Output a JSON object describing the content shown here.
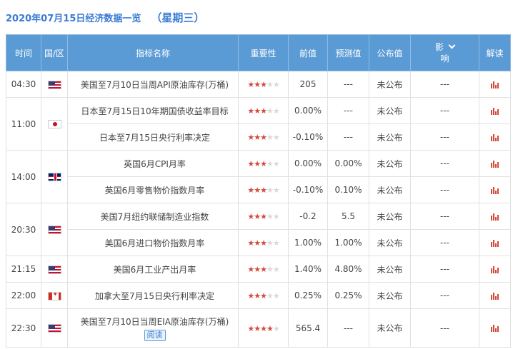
{
  "header": {
    "date_title": "2020年07月15日经济数据一览",
    "weekday": "（星期三）"
  },
  "columns": {
    "time": "时间",
    "region": "国/区",
    "indicator": "指标名称",
    "importance": "重要性",
    "previous": "前值",
    "forecast": "预测值",
    "actual": "公布值",
    "effect_line1": "影",
    "effect_line2": "响",
    "analysis": "解读"
  },
  "flag_icons": {
    "US": "flag-us-icon",
    "JP": "flag-jp-icon",
    "GB": "flag-gb-icon",
    "CA": "flag-ca-icon"
  },
  "colors": {
    "header_bg": "#5b9bd5",
    "accent_red": "#c0392b",
    "title_blue": "#3a7bd5"
  },
  "read_label": "阅读",
  "groups": [
    {
      "time": "04:30",
      "country": "US",
      "rows": [
        {
          "name": "美国至7月10日当周API原油库存(万桶)",
          "stars": 3,
          "previous": "205",
          "forecast": "---",
          "actual": "未公布",
          "effect": "---"
        }
      ]
    },
    {
      "time": "11:00",
      "country": "JP",
      "rows": [
        {
          "name": "日本至7月15日10年期国债收益率目标",
          "stars": 3,
          "previous": "0.00%",
          "forecast": "---",
          "actual": "未公布",
          "effect": "---"
        },
        {
          "name": "日本至7月15日央行利率决定",
          "stars": 3,
          "previous": "-0.10%",
          "forecast": "---",
          "actual": "未公布",
          "effect": "---"
        }
      ]
    },
    {
      "time": "14:00",
      "country": "GB",
      "rows": [
        {
          "name": "英国6月CPI月率",
          "stars": 3,
          "previous": "0.00%",
          "forecast": "0.00%",
          "actual": "未公布",
          "effect": "---"
        },
        {
          "name": "英国6月零售物价指数月率",
          "stars": 3,
          "previous": "-0.10%",
          "forecast": "0.10%",
          "actual": "未公布",
          "effect": "---"
        }
      ]
    },
    {
      "time": "20:30",
      "country": "US",
      "rows": [
        {
          "name": "美国7月纽约联储制造业指数",
          "stars": 3,
          "previous": "-0.2",
          "forecast": "5.5",
          "actual": "未公布",
          "effect": "---"
        },
        {
          "name": "美国6月进口物价指数月率",
          "stars": 3,
          "previous": "1.00%",
          "forecast": "1.00%",
          "actual": "未公布",
          "effect": "---"
        }
      ]
    },
    {
      "time": "21:15",
      "country": "US",
      "rows": [
        {
          "name": "美国6月工业产出月率",
          "stars": 3,
          "previous": "1.40%",
          "forecast": "4.80%",
          "actual": "未公布",
          "effect": "---"
        }
      ]
    },
    {
      "time": "22:00",
      "country": "CA",
      "rows": [
        {
          "name": "加拿大至7月15日央行利率决定",
          "stars": 3,
          "previous": "0.25%",
          "forecast": "0.25%",
          "actual": "未公布",
          "effect": "---"
        }
      ]
    },
    {
      "time": "22:30",
      "country": "US",
      "rows": [
        {
          "name": "美国至7月10日当周EIA原油库存(万桶)",
          "stars": 4,
          "previous": "565.4",
          "forecast": "---",
          "actual": "未公布",
          "effect": "---",
          "has_read": true
        }
      ]
    }
  ]
}
